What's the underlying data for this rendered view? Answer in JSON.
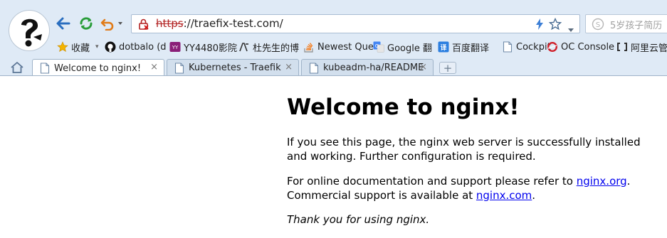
{
  "browser": {
    "address_url_protocol": "https",
    "address_url_rest": "://traefix-test.com/",
    "search_placeholder": "5岁孩子简历",
    "bookmarks": [
      {
        "label": "收藏",
        "icon": "star-icon"
      },
      {
        "label": "dotbalo (d",
        "icon": "github-icon"
      },
      {
        "label": "YY4480影院",
        "icon": "film-icon"
      },
      {
        "label": "杜先生的博",
        "icon": "blog-icon"
      },
      {
        "label": "Newest Que",
        "icon": "stack-icon"
      },
      {
        "label": "Google 翻",
        "icon": "translate-icon"
      },
      {
        "label": "百度翻译",
        "icon": "baidu-translate-icon"
      },
      {
        "label": "Cockpit",
        "icon": "page-icon"
      },
      {
        "label": "OC Console",
        "icon": "openshift-icon"
      },
      {
        "label": "阿里云管理",
        "icon": "aliyun-icon"
      }
    ],
    "tabs": [
      {
        "label": "Welcome to nginx!",
        "close": "×",
        "active": true
      },
      {
        "label": "Kubernetes - Traefik",
        "close": "×",
        "active": false
      },
      {
        "label": "kubeadm-ha/README",
        "close": "×",
        "active": false
      }
    ],
    "new_tab_label": "+"
  },
  "page": {
    "title": "Welcome to nginx!",
    "para1": "If you see this page, the nginx web server is successfully installed and working. Further configuration is required.",
    "para2_pre": "For online documentation and support please refer to ",
    "para2_link1": "nginx.org",
    "para2_mid": ". Commercial support is available at ",
    "para2_link2": "nginx.com",
    "para2_post": ".",
    "para3": "Thank you for using nginx."
  },
  "colors": {
    "chrome_bg": "#dfeaf6",
    "link": "#0000ee",
    "insecure_protocol": "#b22222"
  }
}
